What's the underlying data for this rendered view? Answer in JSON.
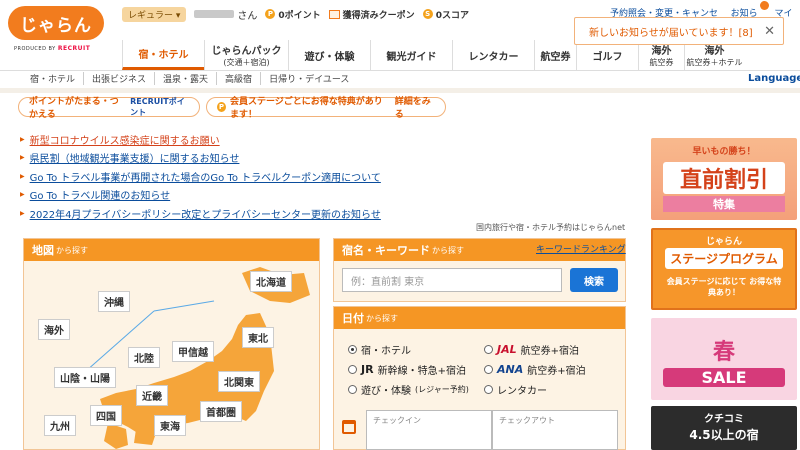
{
  "logo": {
    "text": "じゃらん",
    "produced_by": "PRODUCED BY",
    "brand": "RECRUIT"
  },
  "user": {
    "rank": "レギュラー",
    "name_suffix": "さん",
    "points_label": "0ポイント",
    "coupon_label": "獲得済みクーポン",
    "score_label": "0スコア"
  },
  "top_links": [
    "予約照会・変更・キャンセル",
    "お知らせ",
    "マイペ"
  ],
  "notification": {
    "text": "新しいお知らせが届いています！[8]"
  },
  "nav": [
    {
      "label": "宿・ホテル",
      "sub": ""
    },
    {
      "label": "じゃらんパック",
      "sub": "(交通＋宿泊)"
    },
    {
      "label": "遊び・体験",
      "sub": ""
    },
    {
      "label": "観光ガイド",
      "sub": ""
    },
    {
      "label": "レンタカー",
      "sub": ""
    },
    {
      "label": "航空券",
      "sub": ""
    },
    {
      "label": "ゴルフ",
      "sub": ""
    },
    {
      "label": "海外",
      "sub": "航空券"
    },
    {
      "label": "海外",
      "sub": "航空券＋ホテル"
    }
  ],
  "subnav": [
    "宿・ホテル",
    "出張ビジネス",
    "温泉・露天",
    "高級宿",
    "日帰り・デイユース"
  ],
  "language": "Languages",
  "banners": {
    "points": "ポイントがたまる・つかえる",
    "recruit_point": "RECRUITポイント",
    "member": "会員ステージごとにお得な特典があります！",
    "member_detail": "詳細をみる"
  },
  "info_links": [
    "新型コロナウイルス感染症に関するお願い",
    "県民割（地域観光事業支援）に関するお知らせ",
    "Go To トラベル事業が再開された場合のGo To トラベルクーポン適用について",
    "Go To トラベル関連のお知らせ",
    "2022年4月プライバシーポリシー改定とプライバシーセンター更新のお知らせ"
  ],
  "tagline": "国内旅行や宿・ホテル予約はじゃらんnet",
  "map": {
    "title": "地図",
    "title_suffix": "から探す",
    "regions": [
      "北海道",
      "沖縄",
      "海外",
      "東北",
      "北陸",
      "甲信越",
      "山陰・山陽",
      "北関東",
      "近畿",
      "四国",
      "首都圏",
      "九州",
      "東海"
    ]
  },
  "keyword": {
    "title": "宿名・キーワード",
    "title_suffix": "から探す",
    "ranking": "キーワードランキング",
    "placeholder": "例：直前割 東京",
    "button": "検索"
  },
  "date_search": {
    "title": "日付",
    "title_suffix": "から探す",
    "options": [
      {
        "label": "宿・ホテル",
        "selected": true
      },
      {
        "logo": "JAL",
        "label": "航空券+宿泊",
        "selected": false
      },
      {
        "logo": "JR",
        "label": "新幹線・特急+宿泊",
        "selected": false
      },
      {
        "logo": "ANA",
        "label": "航空券+宿泊",
        "selected": false
      },
      {
        "label": "遊び・体験",
        "note": "(レジャー予約)",
        "selected": false
      },
      {
        "label": "レンタカー",
        "selected": false
      }
    ],
    "checkin": "チェックイン",
    "checkout": "チェックアウト"
  },
  "ads": [
    {
      "top": "早いもの勝ち！",
      "title": "直前割引",
      "sub": "特集"
    },
    {
      "top": "じゃらん",
      "title": "ステージプログラム",
      "sub": "会員ステージに応じて お得な特典あり！"
    },
    {
      "top": "",
      "title": "春",
      "sub": "SALE"
    },
    {
      "top": "クチコミ",
      "title": "4.5以上の宿",
      "sub": ""
    }
  ],
  "colors": {
    "brand_orange": "#f27c1e",
    "link_blue": "#0b4d9c",
    "search_blue": "#1a74d6"
  }
}
